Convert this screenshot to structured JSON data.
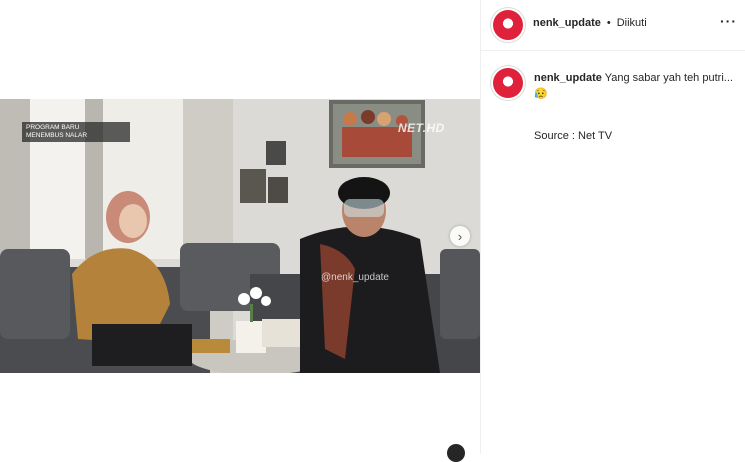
{
  "post": {
    "username": "nenk_update",
    "follow_status": "Diikuti",
    "caption_text": "Yang sabar yah teh putri...",
    "caption_emoji": "😥",
    "source_line": "Source : Net TV"
  },
  "video": {
    "program_label": "PROGRAM BARU",
    "show_title": "MENEMBUS NALAR",
    "channel_logo": "NET.HD",
    "watermark": "@nenk_update"
  },
  "icons": {
    "next": "chevron-right-icon",
    "more": "more-options-icon"
  },
  "colors": {
    "avatar_red": "#e0213b",
    "text": "#262626",
    "divider": "#efefef"
  }
}
